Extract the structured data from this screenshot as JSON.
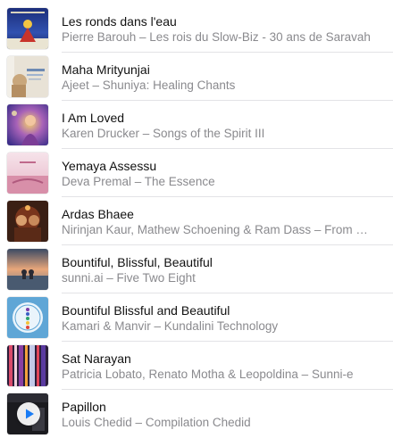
{
  "accent_color": "#1a7cf5",
  "play_icon": "play-icon",
  "tracks": [
    {
      "title": "Les ronds dans l'eau",
      "subtitle": "Pierre Barouh – Les rois du Slow-Biz - 30 ans de Saravah",
      "artwork": "album-cover-les-rois-du-slow-biz"
    },
    {
      "title": "Maha Mrityunjai",
      "subtitle": "Ajeet – Shuniya: Healing Chants",
      "artwork": "album-cover-shuniya"
    },
    {
      "title": "I Am Loved",
      "subtitle": "Karen Drucker – Songs of the Spirit III",
      "artwork": "album-cover-songs-of-the-spirit"
    },
    {
      "title": "Yemaya Assessu",
      "subtitle": "Deva Premal – The Essence",
      "artwork": "album-cover-the-essence"
    },
    {
      "title": "Ardas Bhaee",
      "subtitle": "Nirinjan Kaur, Mathew Schoening & Ram Dass – From Within",
      "artwork": "album-cover-from-within"
    },
    {
      "title": "Bountiful, Blissful, Beautiful",
      "subtitle": "sunni.ai – Five Two Eight",
      "artwork": "album-cover-five-two-eight"
    },
    {
      "title": "Bountiful Blissful and Beautiful",
      "subtitle": "Kamari & Manvir – Kundalini Technology",
      "artwork": "album-cover-kundalini-technology"
    },
    {
      "title": "Sat Narayan",
      "subtitle": "Patricia Lobato, Renato Motha & Leopoldina – Sunni-e",
      "artwork": "album-cover-sunni-e"
    },
    {
      "title": "Papillon",
      "subtitle": "Louis Chedid – Compilation Chedid",
      "artwork": "album-cover-compilation-chedid"
    }
  ]
}
